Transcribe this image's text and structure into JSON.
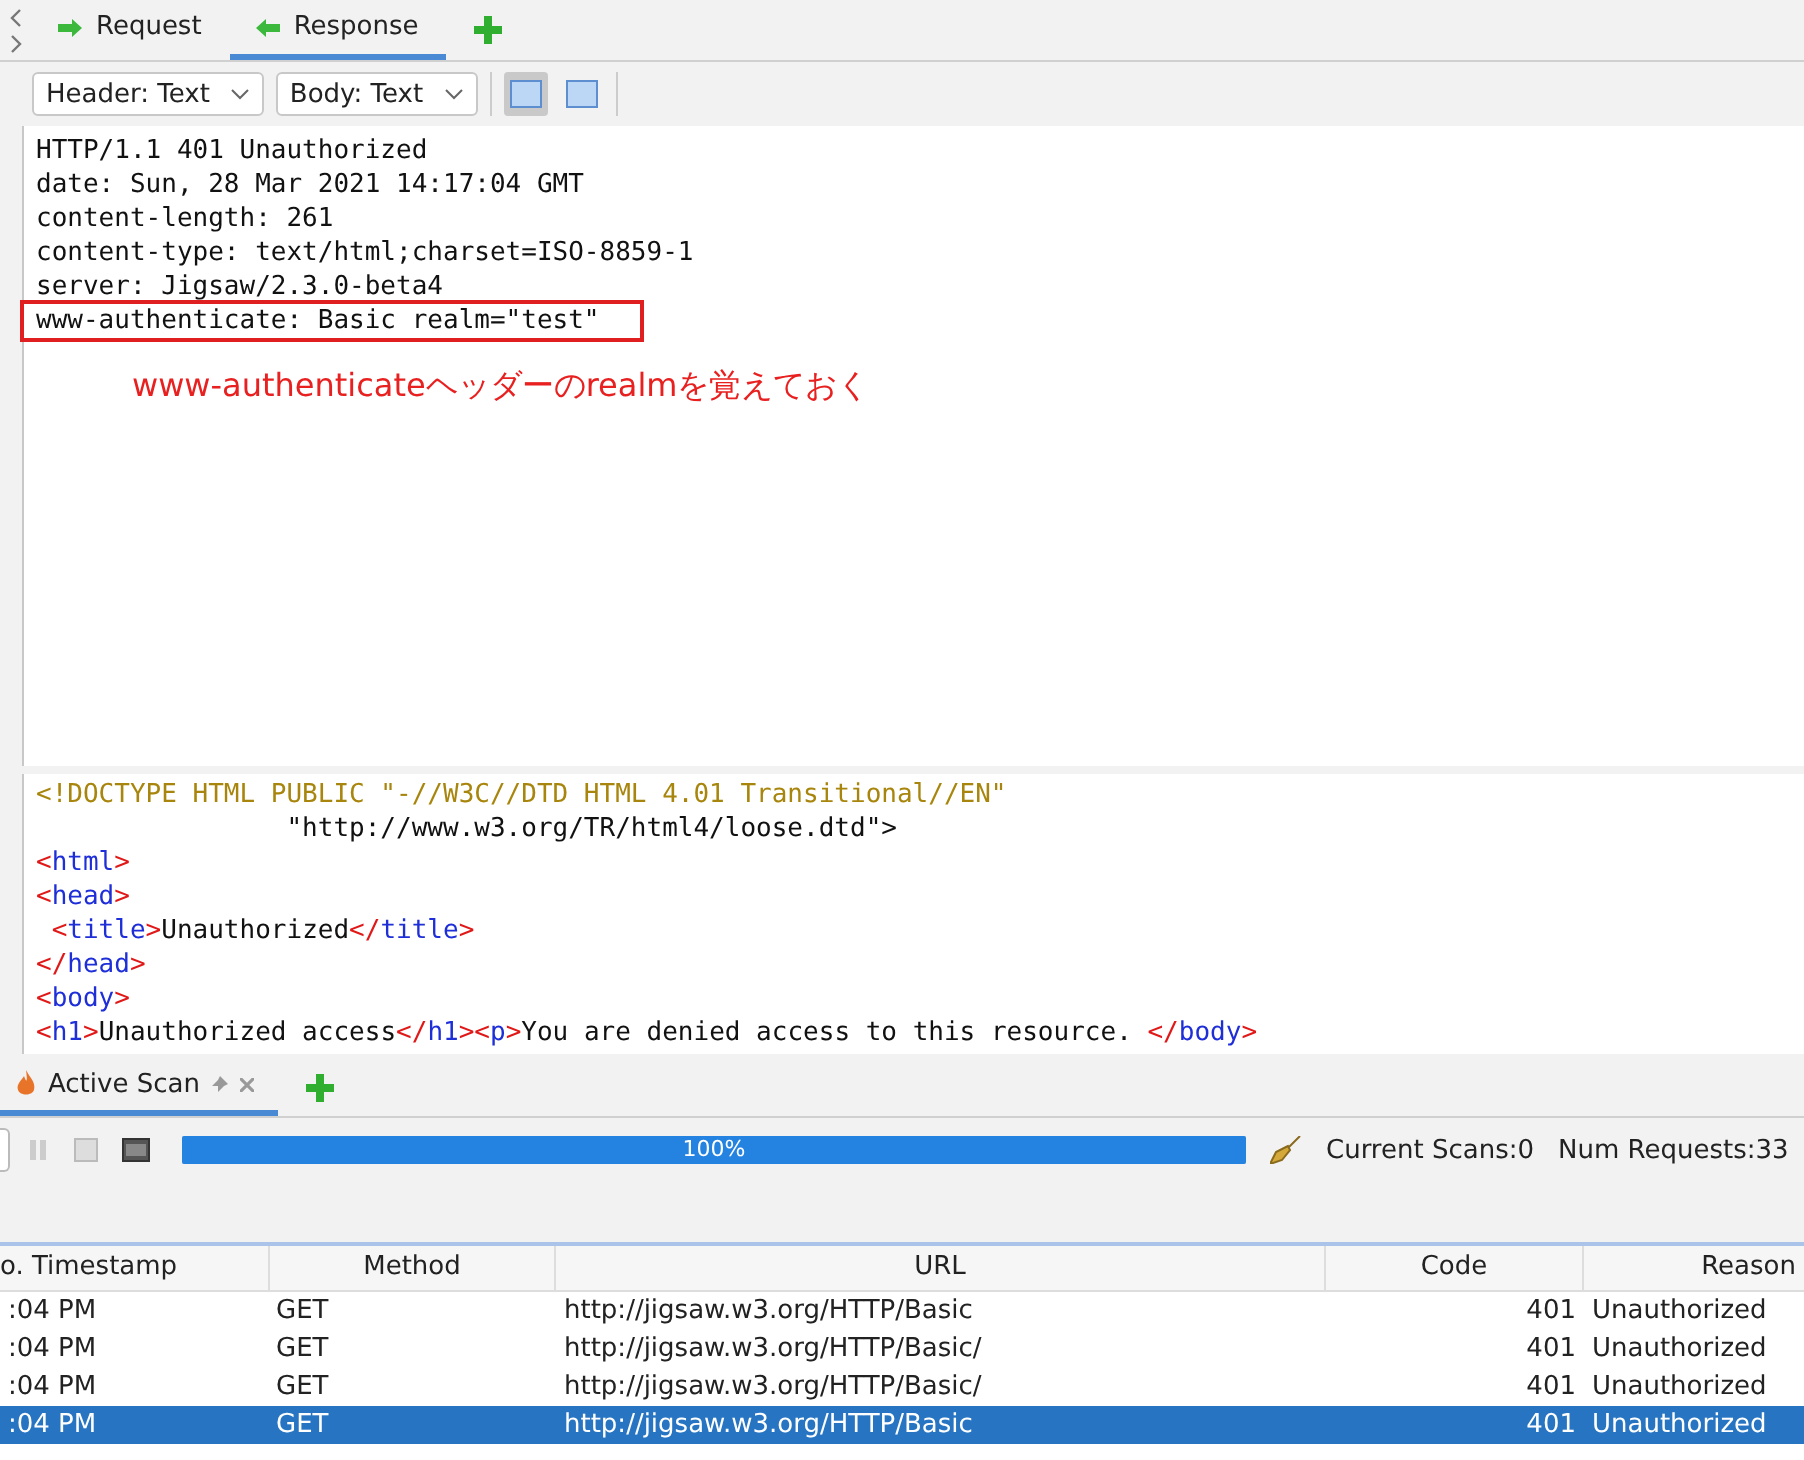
{
  "tabs": [
    {
      "label": "Request",
      "selected": false
    },
    {
      "label": "Response",
      "selected": true
    }
  ],
  "toolbar": {
    "dropdowns": [
      "Header: Text",
      "Body: Text"
    ],
    "views": [
      {
        "selected": true
      },
      {
        "selected": false
      }
    ]
  },
  "header_lines": [
    {
      "text": "HTTP/1.1 401 Unauthorized",
      "highlighted": false
    },
    {
      "text": "date: Sun, 28 Mar 2021 14:17:04 GMT",
      "highlighted": false
    },
    {
      "text": "content-length: 261",
      "highlighted": false
    },
    {
      "text": "content-type: text/html;charset=ISO-8859-1",
      "highlighted": false
    },
    {
      "text": "server: Jigsaw/2.3.0-beta4",
      "highlighted": false
    },
    {
      "text": "www-authenticate: Basic realm=\"test\"",
      "highlighted": true
    }
  ],
  "annotation": "www-authenticateヘッダーのrealmを覚えておく",
  "body_lines": [
    [
      {
        "kind": "doctype",
        "text": "<!DOCTYPE HTML PUBLIC \"-//W3C//DTD HTML 4.01 Transitional//EN\""
      }
    ],
    [
      {
        "kind": "text",
        "text": "                \"http://www.w3.org/TR/html4/loose.dtd\">"
      }
    ],
    [
      {
        "kind": "punct",
        "text": "<"
      },
      {
        "kind": "tag",
        "text": "html"
      },
      {
        "kind": "punct",
        "text": ">"
      }
    ],
    [
      {
        "kind": "punct",
        "text": "<"
      },
      {
        "kind": "tag",
        "text": "head"
      },
      {
        "kind": "punct",
        "text": ">"
      }
    ],
    [
      {
        "kind": "punct",
        "text": " <"
      },
      {
        "kind": "tag",
        "text": "title"
      },
      {
        "kind": "punct",
        "text": ">"
      },
      {
        "kind": "text",
        "text": "Unauthorized"
      },
      {
        "kind": "punct",
        "text": "</"
      },
      {
        "kind": "tag",
        "text": "title"
      },
      {
        "kind": "punct",
        "text": ">"
      }
    ],
    [
      {
        "kind": "punct",
        "text": "</"
      },
      {
        "kind": "tag",
        "text": "head"
      },
      {
        "kind": "punct",
        "text": ">"
      }
    ],
    [
      {
        "kind": "punct",
        "text": "<"
      },
      {
        "kind": "tag",
        "text": "body"
      },
      {
        "kind": "punct",
        "text": ">"
      }
    ],
    [
      {
        "kind": "punct",
        "text": "<"
      },
      {
        "kind": "tag",
        "text": "h1"
      },
      {
        "kind": "punct",
        "text": ">"
      },
      {
        "kind": "text",
        "text": "Unauthorized access"
      },
      {
        "kind": "punct",
        "text": "</"
      },
      {
        "kind": "tag",
        "text": "h1"
      },
      {
        "kind": "punct",
        "text": "><"
      },
      {
        "kind": "tag",
        "text": "p"
      },
      {
        "kind": "punct",
        "text": ">"
      },
      {
        "kind": "text",
        "text": "You are denied access to this resource. "
      },
      {
        "kind": "punct",
        "text": "</"
      },
      {
        "kind": "tag",
        "text": "body"
      },
      {
        "kind": "punct",
        "text": ">"
      }
    ]
  ],
  "scan_panel": {
    "tab": "Active Scan",
    "progress": {
      "level": 1.0,
      "reading": "100%"
    },
    "current_scans": "Current Scans:0",
    "num_requests": "Num Requests:33"
  },
  "table": {
    "columns": [
      "o. Timestamp",
      "Method",
      "URL",
      "Code",
      "Reason"
    ],
    "rows": [
      {
        "cells": [
          ":04 PM",
          "GET",
          "http://jigsaw.w3.org/HTTP/Basic",
          "401",
          "Unauthorized"
        ],
        "selected": false
      },
      {
        "cells": [
          ":04 PM",
          "GET",
          "http://jigsaw.w3.org/HTTP/Basic/",
          "401",
          "Unauthorized"
        ],
        "selected": false
      },
      {
        "cells": [
          ":04 PM",
          "GET",
          "http://jigsaw.w3.org/HTTP/Basic/",
          "401",
          "Unauthorized"
        ],
        "selected": false
      },
      {
        "cells": [
          ":04 PM",
          "GET",
          "http://jigsaw.w3.org/HTTP/Basic",
          "401",
          "Unauthorized"
        ],
        "selected": true
      }
    ]
  }
}
